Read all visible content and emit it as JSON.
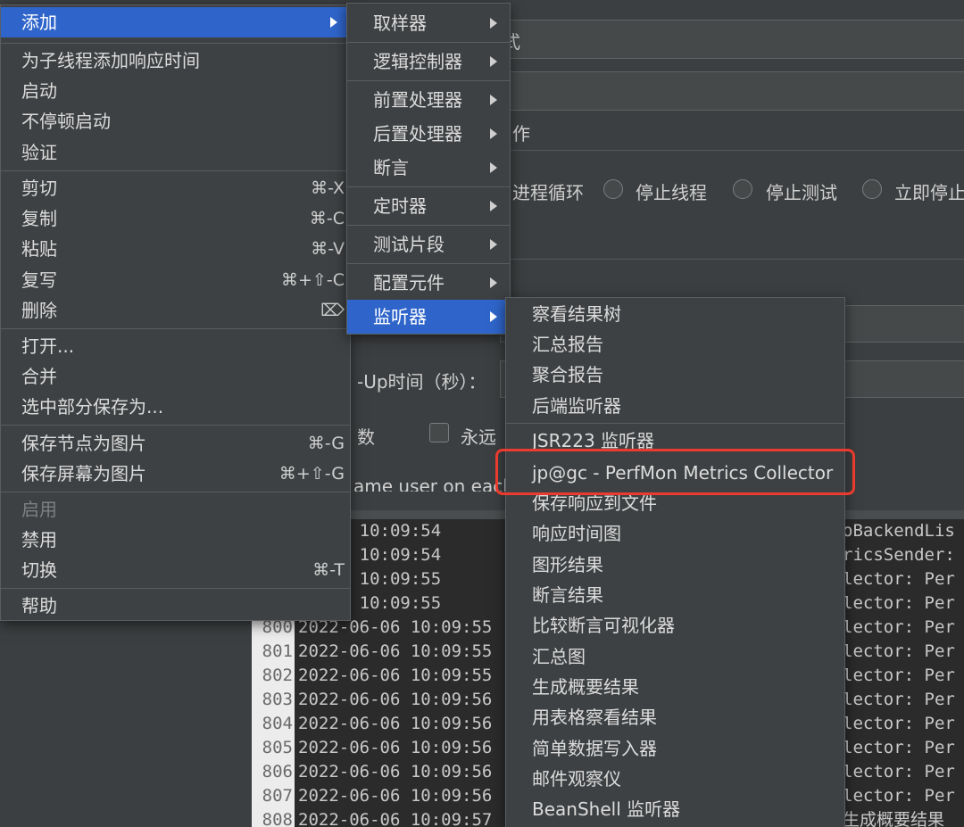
{
  "background": {
    "radio_labels": [
      "进程循环",
      "停止线程",
      "停止测试",
      "立即停止"
    ],
    "partial_labels": {
      "action": "作",
      "ramp": "-Up时间（秒）：",
      "loops": "数",
      "forever": "永远",
      "same_user": "ame user on each",
      "field_frag": "式"
    }
  },
  "log": {
    "rows": [
      {
        "num": "",
        "text": "06-06 10:09:54",
        "tail": "oBackendLis"
      },
      {
        "num": "",
        "text": "06-06 10:09:54",
        "tail": "ricsSender:"
      },
      {
        "num": "",
        "text": "06-06 10:09:55",
        "tail": "lector: Per"
      },
      {
        "num": "",
        "text": "06-06 10:09:55",
        "tail": "lector: Per"
      },
      {
        "num": "800",
        "text": "2022-06-06 10:09:55",
        "tail": "lector: Per"
      },
      {
        "num": "801",
        "text": "2022-06-06 10:09:55",
        "tail": "lector: Per"
      },
      {
        "num": "802",
        "text": "2022-06-06 10:09:55",
        "tail": "lector: Per"
      },
      {
        "num": "803",
        "text": "2022-06-06 10:09:56",
        "tail": "lector: Per"
      },
      {
        "num": "804",
        "text": "2022-06-06 10:09:56",
        "tail": "lector: Per"
      },
      {
        "num": "805",
        "text": "2022-06-06 10:09:56",
        "tail": "lector: Per"
      },
      {
        "num": "806",
        "text": "2022-06-06 10:09:56",
        "tail": "lector: Per"
      },
      {
        "num": "807",
        "text": "2022-06-06 10:09:56",
        "tail": "lector: Per"
      },
      {
        "num": "808",
        "text": "2022-06-06 10:09:57",
        "tail": "生成概要结果"
      }
    ]
  },
  "menu_main": {
    "items": [
      {
        "label": "添加",
        "shortcut": "",
        "submenu": true,
        "selected": true
      },
      {
        "label": "为子线程添加响应时间",
        "shortcut": ""
      },
      {
        "label": "启动",
        "shortcut": ""
      },
      {
        "label": "不停顿启动",
        "shortcut": ""
      },
      {
        "label": "验证",
        "shortcut": ""
      },
      {
        "label": "剪切",
        "shortcut": "⌘-X"
      },
      {
        "label": "复制",
        "shortcut": "⌘-C"
      },
      {
        "label": "粘贴",
        "shortcut": "⌘-V"
      },
      {
        "label": "复写",
        "shortcut": "⌘+⇧-C"
      },
      {
        "label": "删除",
        "shortcut": "⌦"
      },
      {
        "label": "打开...",
        "shortcut": ""
      },
      {
        "label": "合并",
        "shortcut": ""
      },
      {
        "label": "选中部分保存为...",
        "shortcut": ""
      },
      {
        "label": "保存节点为图片",
        "shortcut": "⌘-G"
      },
      {
        "label": "保存屏幕为图片",
        "shortcut": "⌘+⇧-G"
      },
      {
        "label": "启用",
        "shortcut": "",
        "disabled": true
      },
      {
        "label": "禁用",
        "shortcut": ""
      },
      {
        "label": "切换",
        "shortcut": "⌘-T"
      },
      {
        "label": "帮助",
        "shortcut": ""
      }
    ]
  },
  "menu_add": {
    "items": [
      {
        "label": "取样器"
      },
      {
        "label": "逻辑控制器"
      },
      {
        "label": "前置处理器"
      },
      {
        "label": "后置处理器"
      },
      {
        "label": "断言"
      },
      {
        "label": "定时器"
      },
      {
        "label": "测试片段"
      },
      {
        "label": "配置元件"
      },
      {
        "label": "监听器",
        "selected": true
      }
    ]
  },
  "menu_listener": {
    "items": [
      {
        "label": "察看结果树"
      },
      {
        "label": "汇总报告"
      },
      {
        "label": "聚合报告"
      },
      {
        "label": "后端监听器"
      },
      {
        "label": "JSR223 监听器"
      },
      {
        "label": "jp@gc - PerfMon Metrics Collector",
        "highlighted": true
      },
      {
        "label": "保存响应到文件"
      },
      {
        "label": "响应时间图"
      },
      {
        "label": "图形结果"
      },
      {
        "label": "断言结果"
      },
      {
        "label": "比较断言可视化器"
      },
      {
        "label": "汇总图"
      },
      {
        "label": "生成概要结果"
      },
      {
        "label": "用表格察看结果"
      },
      {
        "label": "简单数据写入器"
      },
      {
        "label": "邮件观察仪"
      },
      {
        "label": "BeanShell 监听器"
      }
    ]
  },
  "colors": {
    "selection": "#2f65ca",
    "highlight_box": "#ea3b2e"
  }
}
